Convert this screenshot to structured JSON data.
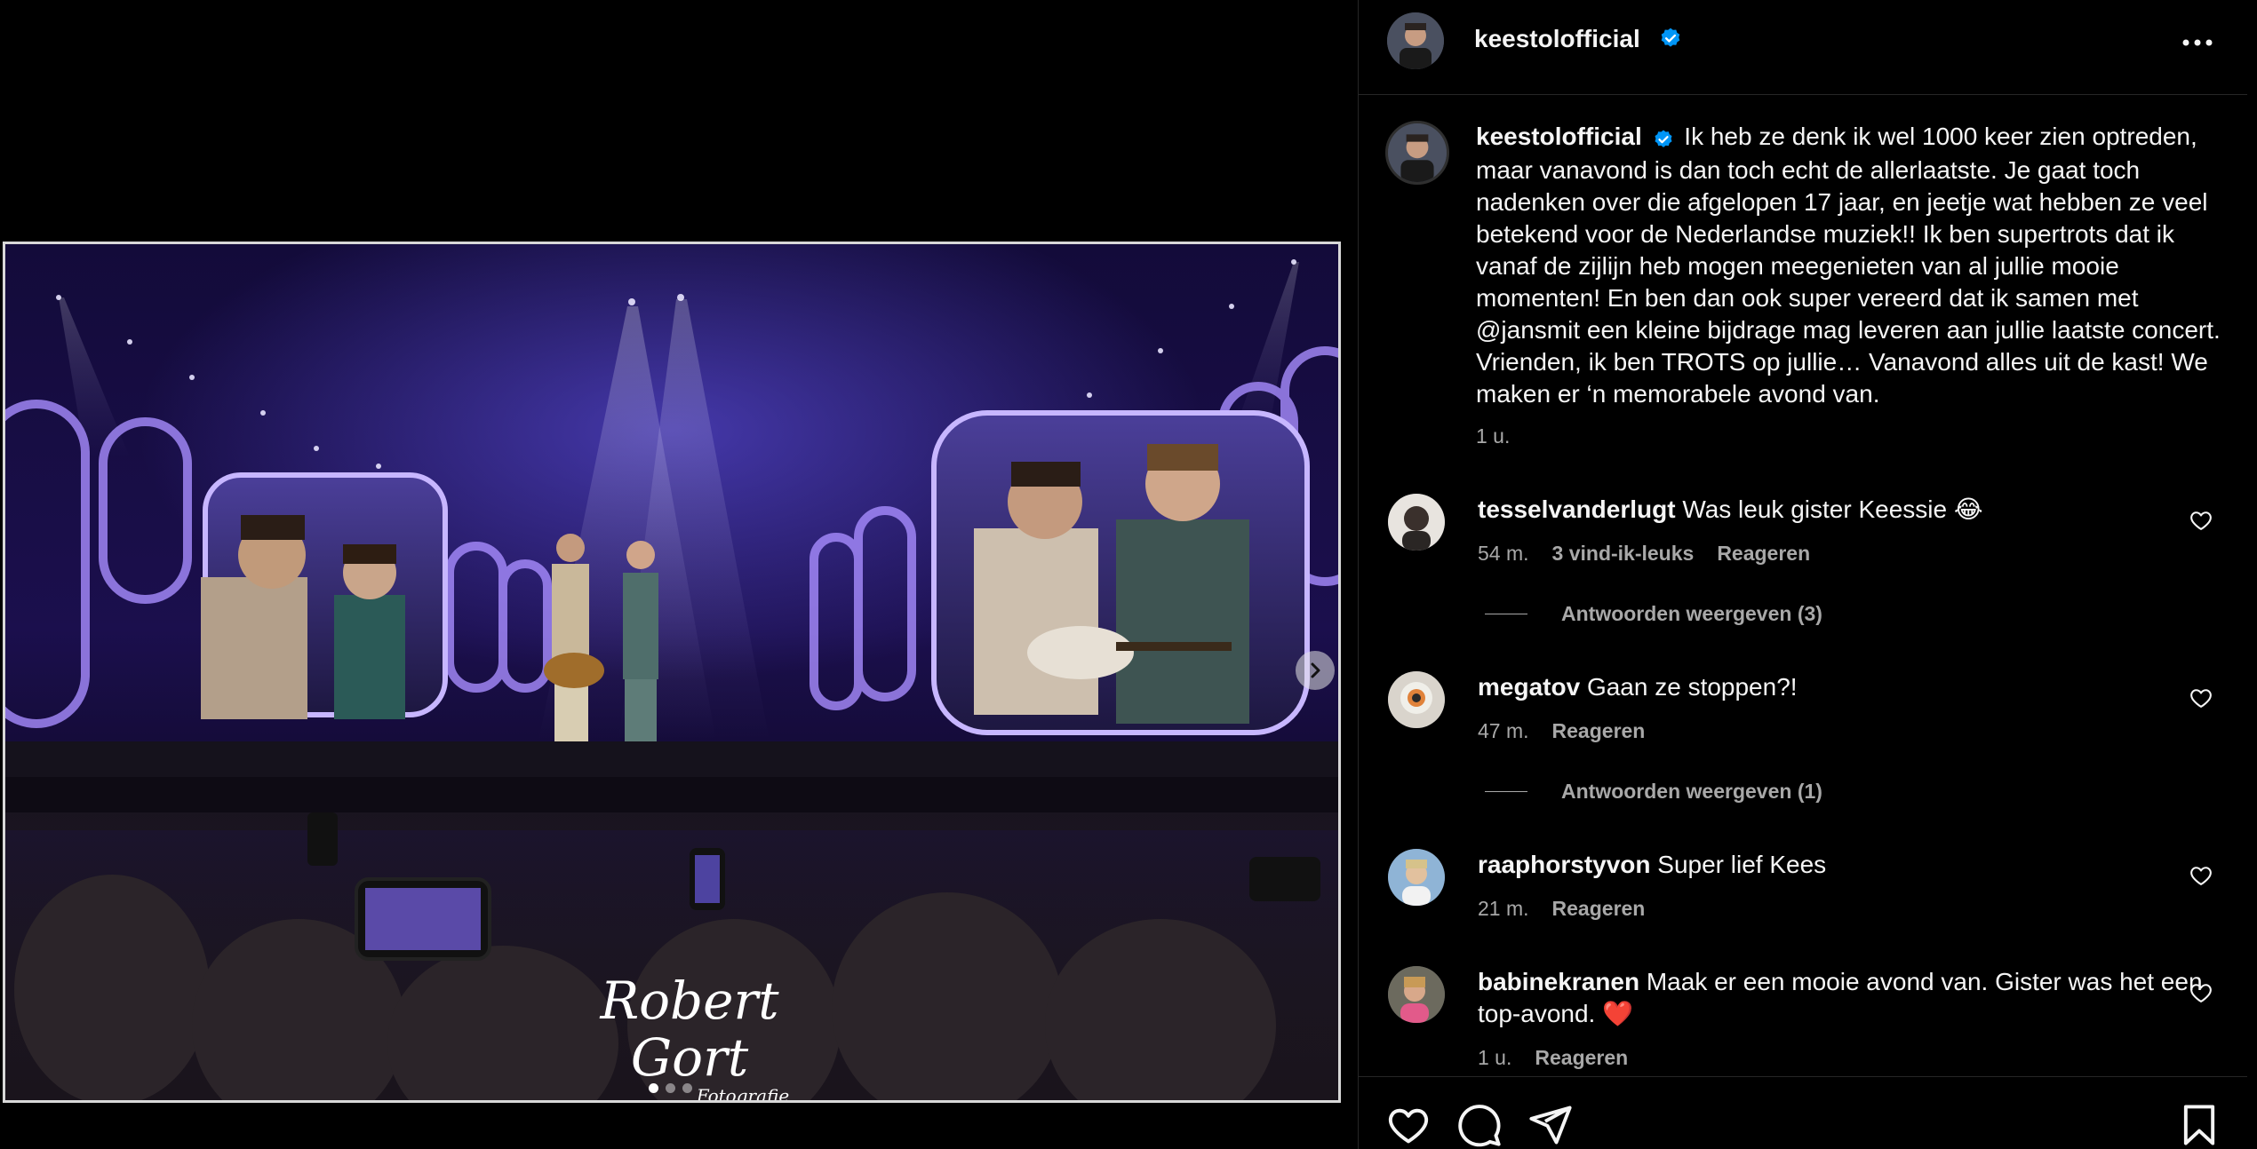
{
  "post": {
    "author": "keestolofficial",
    "caption": "Ik heb ze denk ik wel 1000 keer zien optreden, maar vanavond is dan toch echt de allerlaatste. Je gaat toch nadenken over die afgelopen 17 jaar, en jeetje wat hebben ze veel betekend voor de Nederlandse muziek!! Ik ben supertrots dat ik vanaf de zijlijn heb mogen meegenieten van al jullie mooie momenten! En ben dan ook super vereerd dat ik samen met @jansmit een kleine bijdrage mag leveren aan jullie laatste concert. Vrienden, ik ben TROTS op jullie… Vanavond alles uit de kast! We maken er ‘n memorabele avond van.",
    "time": "1 u.",
    "watermark_line1": "Robert Gort",
    "watermark_line2": "Fotografie",
    "carousel": {
      "count": 3,
      "active_index": 1
    }
  },
  "comments": [
    {
      "user": "tesselvanderlugt",
      "text": "Was leuk gister Keessie 😂",
      "time": "54 m.",
      "likes": "3 vind-ik-leuks",
      "reply": "Reageren",
      "view_replies": "Antwoorden weergeven (3)"
    },
    {
      "user": "megatov",
      "text": "Gaan ze stoppen?!",
      "time": "47 m.",
      "reply": "Reageren",
      "view_replies": "Antwoorden weergeven (1)"
    },
    {
      "user": "raaphorstyvon",
      "text": "Super lief Kees",
      "time": "21 m.",
      "reply": "Reageren"
    },
    {
      "user": "babinekranen",
      "text": "Maak er een mooie avond van. Gister was het een top-avond. ❤️",
      "time": "1 u.",
      "reply": "Reageren"
    }
  ],
  "icons": {
    "verified": "verified-badge-icon",
    "more": "more-options-icon",
    "like": "heart-icon",
    "comment": "comment-bubble-icon",
    "share": "paper-plane-icon",
    "save": "bookmark-icon",
    "next": "chevron-right-icon"
  },
  "colors": {
    "background": "#000000",
    "text": "#f5f5f5",
    "secondary": "#a8a8a8",
    "verified": "#0095f6"
  }
}
